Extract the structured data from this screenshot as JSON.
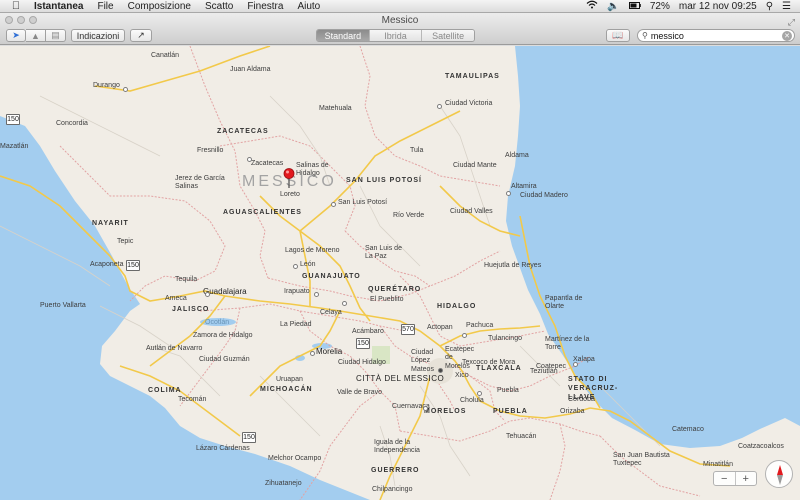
{
  "menubar": {
    "app_name": "Istantanea",
    "menus": [
      "File",
      "Composizione",
      "Scatto",
      "Finestra",
      "Aiuto"
    ],
    "battery": "72%",
    "datetime": "mar 12 nov  09:25"
  },
  "window": {
    "title": "Messico"
  },
  "toolbar": {
    "directions_label": "Indicazioni",
    "map_modes": [
      "Standard",
      "Ibrida",
      "Satellite"
    ],
    "active_mode": "Standard",
    "search_value": "messico"
  },
  "map": {
    "country_label": "MESSICO",
    "states": [
      "TAMAULIPAS",
      "ZACATECAS",
      "SAN LUIS POTOSÍ",
      "AGUASCALIENTES",
      "NAYARIT",
      "GUANAJUATO",
      "QUERÉTARO",
      "HIDALGO",
      "JALISCO",
      "TLAXCALA",
      "COLIMA",
      "MICHOACÁN",
      "MORELOS",
      "PUEBLA",
      "STATO DI VERACRUZ-LLAVE",
      "GUERRERO"
    ],
    "capital": "CITTÀ DEL MESSICO",
    "cities": [
      "Canatlán",
      "Durango",
      "Juan Aldama",
      "Ciudad Victoria",
      "Concordia",
      "Mazatlán",
      "Matehuala",
      "Fresnillo",
      "Zacatecas",
      "Salinas de Hidalgo",
      "Jerez de García Salinas",
      "Loreto",
      "Ciudad Mante",
      "Tula",
      "Aldama",
      "Altamira",
      "Ciudad Madero",
      "San Luis Potosí",
      "Río Verde",
      "Ciudad Valles",
      "Acaponeta",
      "Tepic",
      "Lagos de Moreno",
      "León",
      "San Luis de La Paz",
      "Huejutla de Reyes",
      "Tequila",
      "Ameca",
      "Guadalajara",
      "Puerto Vallarta",
      "Irapuato",
      "El Pueblito",
      "Celaya",
      "Papantla de Olarte",
      "Martínez de la Torre",
      "Acámbaro",
      "Actopan",
      "Pachuca",
      "Tulancingo",
      "Zamora de Hidalgo",
      "La Piedad",
      "Morelia",
      "Ciudad Hidalgo",
      "Ciudad López Mateos",
      "Ecatepec de Morelos",
      "Texcoco de Mora",
      "Teziutlán",
      "Xalapa",
      "Autlán de Navarro",
      "Ciudad Guzmán",
      "Xico",
      "Coatepec",
      "Uruapan",
      "Tecomán",
      "Cuernavaca",
      "Cholula",
      "Puebla",
      "Córdoba",
      "Orizaba",
      "Valle de Bravo",
      "Iguala de la Independencia",
      "Tehuacán",
      "Catemaco",
      "Coatzacoalcos",
      "Lázaro Cárdenas",
      "Melchor Ocampo",
      "San Juan Bautista Tuxtepec",
      "Minatitlán",
      "Zihuatanejo",
      "Chilpancingo"
    ],
    "water_labels": [
      "Ocotlán"
    ],
    "route_shields": [
      "150",
      "150",
      "570",
      "150",
      "150"
    ],
    "colors": {
      "water": "#a3cdef",
      "land": "#f1ede6",
      "state_border": "#e2a3a3",
      "highway": "#f2c94a",
      "road": "#d8d2c8"
    }
  },
  "controls": {
    "zoom_out": "−",
    "zoom_in": "+"
  }
}
